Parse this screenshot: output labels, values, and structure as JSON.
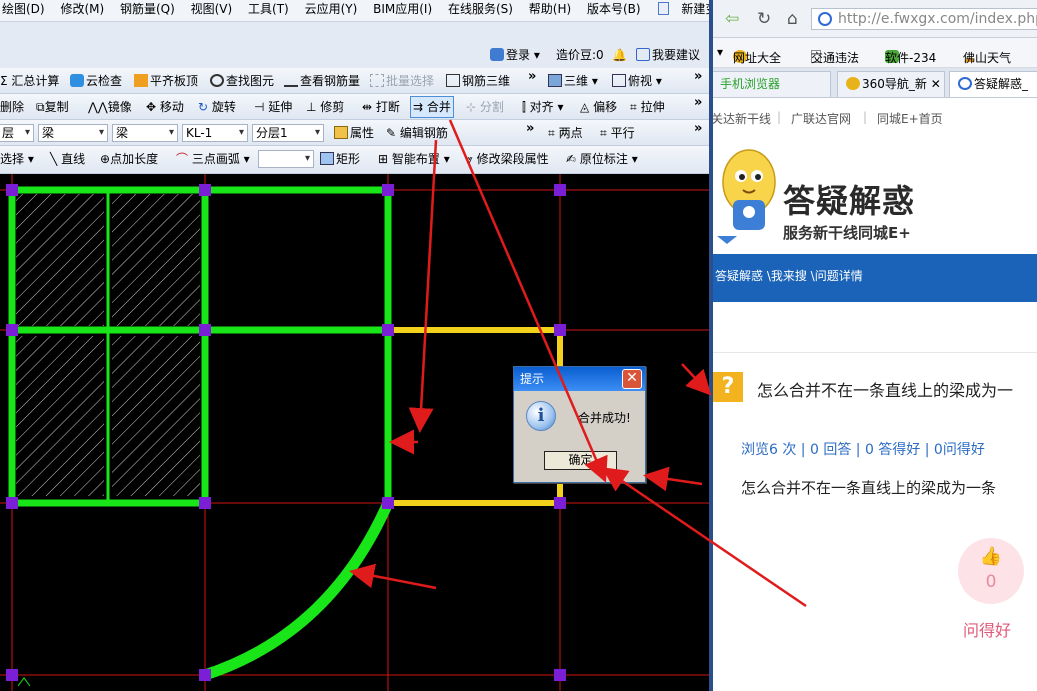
{
  "app": {
    "menubar": [
      "绘图(D)",
      "修改(M)",
      "钢筋量(Q)",
      "视图(V)",
      "工具(T)",
      "云应用(Y)",
      "BIM应用(I)",
      "在线服务(S)",
      "帮助(H)",
      "版本号(B)",
      "新建变更"
    ],
    "loginbar": {
      "login": "登录",
      "price_bean": "造价豆:0",
      "suggest": "我要建议"
    },
    "toolbar1": {
      "summary": "汇总计算",
      "cloud_check": "云检查",
      "align_slab": "平齐板顶",
      "find_element": "查找图元",
      "view_rebar": "查看钢筋量",
      "batch_select": "批量选择",
      "rebar_3d": "钢筋三维",
      "view_3d": "三维",
      "top_view": "俯视"
    },
    "toolbar2": {
      "delete": "删除",
      "copy": "复制",
      "mirror": "镜像",
      "move": "移动",
      "rotate": "旋转",
      "extend": "延伸",
      "trim": "修剪",
      "break": "打断",
      "merge": "合并",
      "split": "分割",
      "align": "对齐",
      "offset": "偏移",
      "stretch": "拉伸"
    },
    "toolbar3": {
      "sel_0": "层",
      "sel_1": "梁",
      "sel_2": "梁",
      "sel_3": "KL-1",
      "sel_4": "分层1",
      "property": "属性",
      "edit_rebar": "编辑钢筋",
      "two_points": "两点",
      "parallel": "平行"
    },
    "toolbar4": {
      "select": "选择",
      "line": "直线",
      "point_length": "点加长度",
      "three_point_arc": "三点画弧",
      "rect": "矩形",
      "smart_layout": "智能布置",
      "modify_span": "修改梁段属性",
      "inplace_mark": "原位标注"
    },
    "dialog": {
      "title": "提示",
      "message": "合并成功!",
      "ok": "确定",
      "close": "✕",
      "info_glyph": "i"
    }
  },
  "browser": {
    "url": "http://e.fwxgx.com/index.php",
    "bookmarks": [
      "网址大全",
      "交通违法",
      "软件-234",
      "佛山天气"
    ],
    "tabs": [
      "手机浏览器",
      "360导航_新",
      "答疑解惑_"
    ],
    "sitenav": [
      "关达新干线",
      "广联达官网",
      "同城E+首页"
    ],
    "logo_title": "答疑解惑",
    "logo_subtitle": "服务新干线同城E+",
    "breadcrumb": "答疑解惑 \\我来搜 \\问题详情",
    "question_title": "怎么合并不在一条直线上的梁成为一",
    "stats": "浏览6 次 | 0 回答 | 0 答得好 | 0问得好",
    "question_body": "怎么合并不在一条直线上的梁成为一条",
    "like_count": "0",
    "like_label": "问得好"
  },
  "colors": {
    "beam_green": "#19e619",
    "beam_yellow": "#f2d21b",
    "axis_red": "#d21414",
    "node_purple": "#7a1fd6",
    "annotation_red": "#e01b1b",
    "brand_blue": "#1a63b8"
  },
  "icons": [
    "sigma-icon",
    "cloud-check-icon",
    "align-icon",
    "find-icon",
    "rebar-icon",
    "copy-icon",
    "mirror-icon",
    "move-icon",
    "rotate-icon",
    "merge-icon",
    "info-icon",
    "back-icon",
    "refresh-icon",
    "home-icon",
    "globe-icon",
    "thumbs-up-icon",
    "question-icon",
    "mascot-icon"
  ]
}
